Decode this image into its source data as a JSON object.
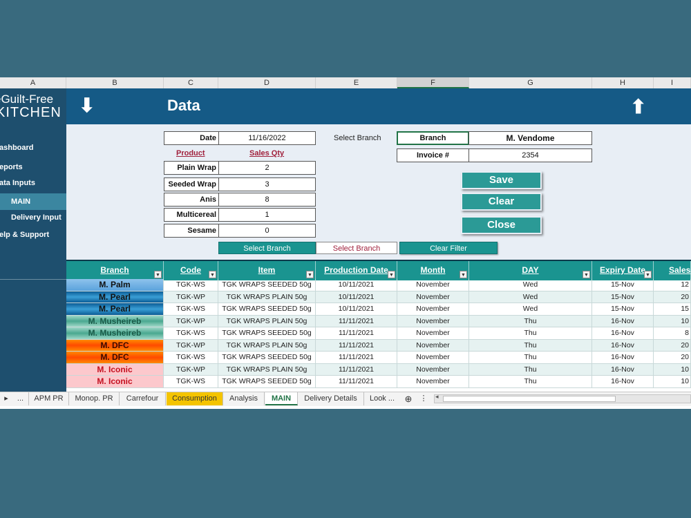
{
  "columns": [
    "A",
    "B",
    "C",
    "D",
    "E",
    "F",
    "G",
    "H",
    "I"
  ],
  "logo": {
    "line1": "eGuilt-Free",
    "line2": "KITCHEN"
  },
  "banner": {
    "title": "Data",
    "down_arrow": "⬇",
    "up_arrow": "⬆"
  },
  "sidebar": {
    "items": [
      {
        "label": "ashboard"
      },
      {
        "label": "eports"
      },
      {
        "label": "ata Inputs"
      },
      {
        "label": "MAIN"
      },
      {
        "label": "Delivery Input"
      },
      {
        "label": "elp & Support"
      }
    ]
  },
  "form": {
    "date_label": "Date",
    "date_value": "11/16/2022",
    "product_header": "Product",
    "sales_qty_header": "Sales Qty",
    "products": [
      {
        "name": "Plain Wrap",
        "qty": "2"
      },
      {
        "name": "Seeded Wrap",
        "qty": "3"
      },
      {
        "name": "Anis",
        "qty": "8"
      },
      {
        "name": "Multicereal",
        "qty": "1"
      },
      {
        "name": "Sesame",
        "qty": "0"
      }
    ],
    "select_branch_text": "Select Branch",
    "branch_label": "Branch",
    "branch_value": "M. Vendome",
    "invoice_label": "Invoice #",
    "invoice_value": "2354",
    "save": "Save",
    "clear": "Clear",
    "close": "Close",
    "filter_select_branch_1": "Select Branch",
    "filter_select_branch_2": "Select Branch",
    "clear_filter": "Clear Filter"
  },
  "table": {
    "headers": [
      "Branch",
      "Code",
      "Item",
      "Production Date",
      "Month",
      "DAY",
      "Expiry Date",
      "Sales"
    ],
    "rows": [
      {
        "branch": "M. Palm",
        "code": "TGK-WS",
        "item": "TGK WRAPS SEEDED 50g",
        "prod": "10/11/2021",
        "month": "November",
        "day": "Wed",
        "expiry": "15-Nov",
        "sales": "12"
      },
      {
        "branch": "M. Pearl",
        "code": "TGK-WP",
        "item": "TGK WRAPS PLAIN 50g",
        "prod": "10/11/2021",
        "month": "November",
        "day": "Wed",
        "expiry": "15-Nov",
        "sales": "20"
      },
      {
        "branch": "M. Pearl",
        "code": "TGK-WS",
        "item": "TGK WRAPS SEEDED 50g",
        "prod": "10/11/2021",
        "month": "November",
        "day": "Wed",
        "expiry": "15-Nov",
        "sales": "15"
      },
      {
        "branch": "M. Musheireb",
        "code": "TGK-WP",
        "item": "TGK WRAPS PLAIN 50g",
        "prod": "11/11/2021",
        "month": "November",
        "day": "Thu",
        "expiry": "16-Nov",
        "sales": "10"
      },
      {
        "branch": "M. Musheireb",
        "code": "TGK-WS",
        "item": "TGK WRAPS SEEDED 50g",
        "prod": "11/11/2021",
        "month": "November",
        "day": "Thu",
        "expiry": "16-Nov",
        "sales": "8"
      },
      {
        "branch": "M. DFC",
        "code": "TGK-WP",
        "item": "TGK WRAPS PLAIN 50g",
        "prod": "11/11/2021",
        "month": "November",
        "day": "Thu",
        "expiry": "16-Nov",
        "sales": "20"
      },
      {
        "branch": "M. DFC",
        "code": "TGK-WS",
        "item": "TGK WRAPS SEEDED 50g",
        "prod": "11/11/2021",
        "month": "November",
        "day": "Thu",
        "expiry": "16-Nov",
        "sales": "20"
      },
      {
        "branch": "M. Iconic",
        "code": "TGK-WP",
        "item": "TGK WRAPS PLAIN 50g",
        "prod": "11/11/2021",
        "month": "November",
        "day": "Thu",
        "expiry": "16-Nov",
        "sales": "10"
      },
      {
        "branch": "M. Iconic",
        "code": "TGK-WS",
        "item": "TGK WRAPS SEEDED 50g",
        "prod": "11/11/2021",
        "month": "November",
        "day": "Thu",
        "expiry": "16-Nov",
        "sales": "10"
      }
    ]
  },
  "tabs": [
    "APM PR",
    "Monop. PR",
    "Carrefour",
    "Consumption",
    "Analysis",
    "MAIN",
    "Delivery Details",
    "Look ..."
  ],
  "tab_nav": {
    "next": "▸",
    "more": "...",
    "add": "⊕",
    "menu": "⋮",
    "scroll_left": "◂"
  },
  "colors": {
    "banner": "#155a86",
    "sidebar": "#1e4f6e",
    "teal": "#1a9490",
    "button": "#2b9a96",
    "active_tab": "#217346",
    "highlight_tab": "#f4c400"
  }
}
